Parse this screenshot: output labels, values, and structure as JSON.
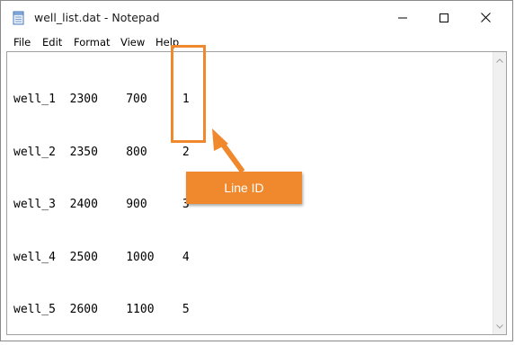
{
  "window": {
    "title": "well_list.dat - Notepad"
  },
  "menu": {
    "file": "File",
    "edit": "Edit",
    "format": "Format",
    "view": "View",
    "help": "Help"
  },
  "document": {
    "lines": [
      "well_1  2300    700     1",
      "well_2  2350    800     2",
      "well_3  2400    900     3",
      "well_4  2500    1000    4",
      "well_5  2600    1100    5"
    ]
  },
  "annotation": {
    "label": "Line ID",
    "color": "#f0892d"
  },
  "icons": {
    "app": "notepad-icon",
    "minimize": "minimize-icon",
    "maximize": "maximize-icon",
    "close": "close-icon"
  }
}
